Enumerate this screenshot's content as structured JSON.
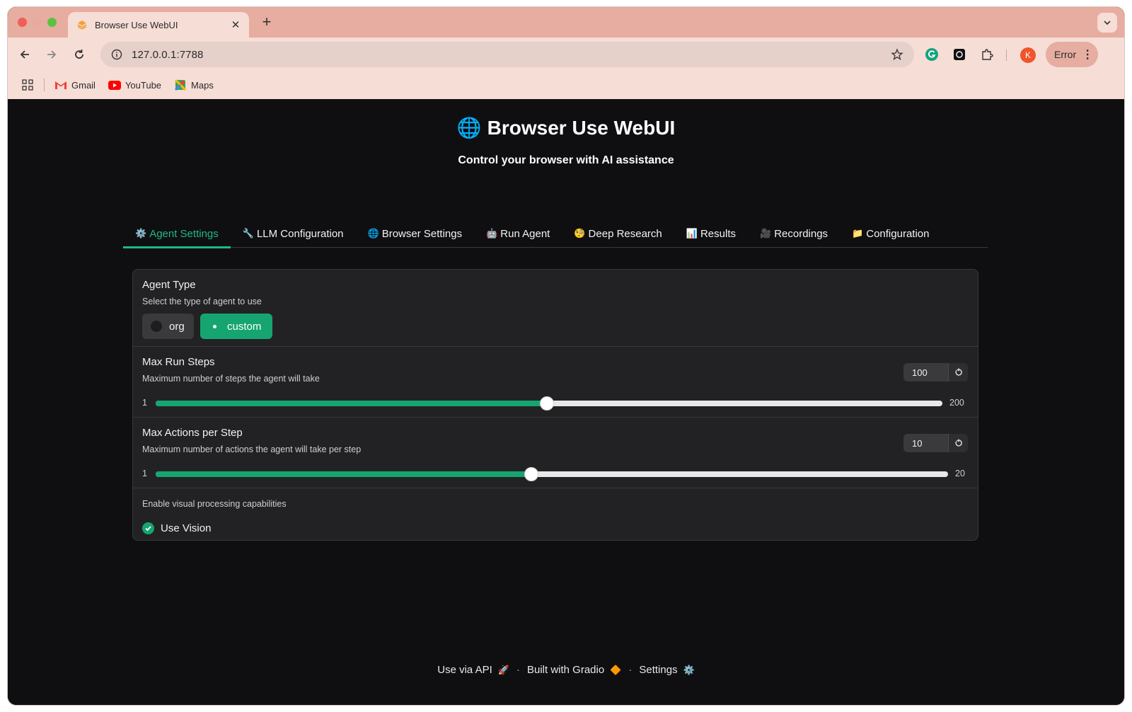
{
  "browser": {
    "tab_title": "Browser Use WebUI",
    "url": "127.0.0.1:7788",
    "error_label": "Error",
    "avatar_initial": "K",
    "bookmarks": [
      {
        "label": "Gmail",
        "icon": "gmail-icon"
      },
      {
        "label": "YouTube",
        "icon": "youtube-icon"
      },
      {
        "label": "Maps",
        "icon": "maps-icon"
      }
    ]
  },
  "header": {
    "title": "Browser Use WebUI",
    "title_icon": "🌐",
    "subtitle": "Control your browser with AI assistance"
  },
  "tabs": [
    {
      "label": "Agent Settings",
      "icon": "⚙️",
      "active": true
    },
    {
      "label": "LLM Configuration",
      "icon": "🔧",
      "active": false
    },
    {
      "label": "Browser Settings",
      "icon": "🌐",
      "active": false
    },
    {
      "label": "Run Agent",
      "icon": "🤖",
      "active": false
    },
    {
      "label": "Deep Research",
      "icon": "🧐",
      "active": false
    },
    {
      "label": "Results",
      "icon": "📊",
      "active": false
    },
    {
      "label": "Recordings",
      "icon": "🎥",
      "active": false
    },
    {
      "label": "Configuration",
      "icon": "📁",
      "active": false
    }
  ],
  "agent_type": {
    "label": "Agent Type",
    "description": "Select the type of agent to use",
    "options": [
      "org",
      "custom"
    ],
    "selected": "custom"
  },
  "max_run_steps": {
    "label": "Max Run Steps",
    "description": "Maximum number of steps the agent will take",
    "value": "100",
    "min": "1",
    "max": "200"
  },
  "max_actions": {
    "label": "Max Actions per Step",
    "description": "Maximum number of actions the agent will take per step",
    "value": "10",
    "min": "1",
    "max": "20"
  },
  "vision": {
    "description": "Enable visual processing capabilities",
    "label": "Use Vision",
    "checked": true
  },
  "footer": {
    "api": "Use via API",
    "api_icon": "🚀",
    "gradio": "Built with Gradio",
    "gradio_icon": "🔶",
    "settings": "Settings",
    "settings_icon": "⚙️"
  },
  "colors": {
    "accent": "#20b883",
    "accent_fill": "#16a571",
    "tab_strip": "#e6ada0",
    "toolbar": "#f6ddd6",
    "page_bg": "#0f0f11",
    "panel_bg": "#222224"
  }
}
